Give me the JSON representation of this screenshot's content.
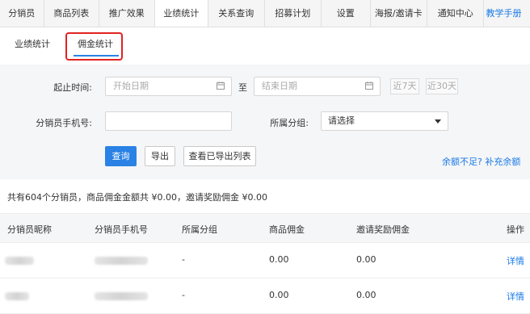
{
  "top_tabs": [
    {
      "label": "分销员"
    },
    {
      "label": "商品列表"
    },
    {
      "label": "推广效果"
    },
    {
      "label": "业绩统计"
    },
    {
      "label": "关系查询"
    },
    {
      "label": "招募计划"
    },
    {
      "label": "设置"
    },
    {
      "label": "海报/邀请卡"
    },
    {
      "label": "通知中心"
    },
    {
      "label": "教学手册"
    }
  ],
  "sub_tabs": [
    {
      "label": "业绩统计"
    },
    {
      "label": "佣金统计"
    }
  ],
  "filters": {
    "time_label": "起止时间:",
    "start_placeholder": "开始日期",
    "to_label": "至",
    "end_placeholder": "结束日期",
    "last7": "近7天",
    "last30": "近30天",
    "phone_label": "分销员手机号:",
    "phone_value": "",
    "group_label": "所属分组:",
    "group_selected": "请选择"
  },
  "actions": {
    "query": "查询",
    "export": "导出",
    "view_exports": "查看已导出列表",
    "top_up_link": "余额不足? 补充余额"
  },
  "summary": "共有604个分销员，商品佣金金额共 ¥0.00，邀请奖励佣金 ¥0.00",
  "table": {
    "headers": [
      "分销员昵称",
      "分销员手机号",
      "所属分组",
      "商品佣金",
      "邀请奖励佣金",
      "操作"
    ],
    "rows": [
      {
        "group": "-",
        "product_commission": "0.00",
        "invite_commission": "0.00",
        "action": "详情"
      },
      {
        "group": "-",
        "product_commission": "0.00",
        "invite_commission": "0.00",
        "action": "详情"
      }
    ]
  },
  "colors": {
    "accent": "#2a82e4",
    "link": "#1a7ae6",
    "highlight": "#e22222"
  }
}
